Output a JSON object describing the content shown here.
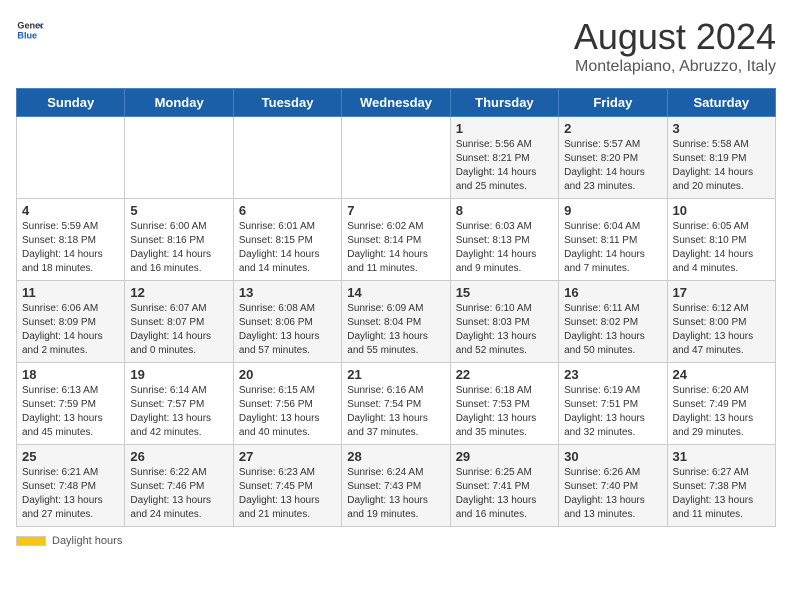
{
  "header": {
    "logo_general": "General",
    "logo_blue": "Blue",
    "month_title": "August 2024",
    "location": "Montelapiano, Abruzzo, Italy"
  },
  "days_of_week": [
    "Sunday",
    "Monday",
    "Tuesday",
    "Wednesday",
    "Thursday",
    "Friday",
    "Saturday"
  ],
  "footer": {
    "daylight_label": "Daylight hours"
  },
  "weeks": [
    [
      {
        "day": "",
        "info": ""
      },
      {
        "day": "",
        "info": ""
      },
      {
        "day": "",
        "info": ""
      },
      {
        "day": "",
        "info": ""
      },
      {
        "day": "1",
        "info": "Sunrise: 5:56 AM\nSunset: 8:21 PM\nDaylight: 14 hours\nand 25 minutes."
      },
      {
        "day": "2",
        "info": "Sunrise: 5:57 AM\nSunset: 8:20 PM\nDaylight: 14 hours\nand 23 minutes."
      },
      {
        "day": "3",
        "info": "Sunrise: 5:58 AM\nSunset: 8:19 PM\nDaylight: 14 hours\nand 20 minutes."
      }
    ],
    [
      {
        "day": "4",
        "info": "Sunrise: 5:59 AM\nSunset: 8:18 PM\nDaylight: 14 hours\nand 18 minutes."
      },
      {
        "day": "5",
        "info": "Sunrise: 6:00 AM\nSunset: 8:16 PM\nDaylight: 14 hours\nand 16 minutes."
      },
      {
        "day": "6",
        "info": "Sunrise: 6:01 AM\nSunset: 8:15 PM\nDaylight: 14 hours\nand 14 minutes."
      },
      {
        "day": "7",
        "info": "Sunrise: 6:02 AM\nSunset: 8:14 PM\nDaylight: 14 hours\nand 11 minutes."
      },
      {
        "day": "8",
        "info": "Sunrise: 6:03 AM\nSunset: 8:13 PM\nDaylight: 14 hours\nand 9 minutes."
      },
      {
        "day": "9",
        "info": "Sunrise: 6:04 AM\nSunset: 8:11 PM\nDaylight: 14 hours\nand 7 minutes."
      },
      {
        "day": "10",
        "info": "Sunrise: 6:05 AM\nSunset: 8:10 PM\nDaylight: 14 hours\nand 4 minutes."
      }
    ],
    [
      {
        "day": "11",
        "info": "Sunrise: 6:06 AM\nSunset: 8:09 PM\nDaylight: 14 hours\nand 2 minutes."
      },
      {
        "day": "12",
        "info": "Sunrise: 6:07 AM\nSunset: 8:07 PM\nDaylight: 14 hours\nand 0 minutes."
      },
      {
        "day": "13",
        "info": "Sunrise: 6:08 AM\nSunset: 8:06 PM\nDaylight: 13 hours\nand 57 minutes."
      },
      {
        "day": "14",
        "info": "Sunrise: 6:09 AM\nSunset: 8:04 PM\nDaylight: 13 hours\nand 55 minutes."
      },
      {
        "day": "15",
        "info": "Sunrise: 6:10 AM\nSunset: 8:03 PM\nDaylight: 13 hours\nand 52 minutes."
      },
      {
        "day": "16",
        "info": "Sunrise: 6:11 AM\nSunset: 8:02 PM\nDaylight: 13 hours\nand 50 minutes."
      },
      {
        "day": "17",
        "info": "Sunrise: 6:12 AM\nSunset: 8:00 PM\nDaylight: 13 hours\nand 47 minutes."
      }
    ],
    [
      {
        "day": "18",
        "info": "Sunrise: 6:13 AM\nSunset: 7:59 PM\nDaylight: 13 hours\nand 45 minutes."
      },
      {
        "day": "19",
        "info": "Sunrise: 6:14 AM\nSunset: 7:57 PM\nDaylight: 13 hours\nand 42 minutes."
      },
      {
        "day": "20",
        "info": "Sunrise: 6:15 AM\nSunset: 7:56 PM\nDaylight: 13 hours\nand 40 minutes."
      },
      {
        "day": "21",
        "info": "Sunrise: 6:16 AM\nSunset: 7:54 PM\nDaylight: 13 hours\nand 37 minutes."
      },
      {
        "day": "22",
        "info": "Sunrise: 6:18 AM\nSunset: 7:53 PM\nDaylight: 13 hours\nand 35 minutes."
      },
      {
        "day": "23",
        "info": "Sunrise: 6:19 AM\nSunset: 7:51 PM\nDaylight: 13 hours\nand 32 minutes."
      },
      {
        "day": "24",
        "info": "Sunrise: 6:20 AM\nSunset: 7:49 PM\nDaylight: 13 hours\nand 29 minutes."
      }
    ],
    [
      {
        "day": "25",
        "info": "Sunrise: 6:21 AM\nSunset: 7:48 PM\nDaylight: 13 hours\nand 27 minutes."
      },
      {
        "day": "26",
        "info": "Sunrise: 6:22 AM\nSunset: 7:46 PM\nDaylight: 13 hours\nand 24 minutes."
      },
      {
        "day": "27",
        "info": "Sunrise: 6:23 AM\nSunset: 7:45 PM\nDaylight: 13 hours\nand 21 minutes."
      },
      {
        "day": "28",
        "info": "Sunrise: 6:24 AM\nSunset: 7:43 PM\nDaylight: 13 hours\nand 19 minutes."
      },
      {
        "day": "29",
        "info": "Sunrise: 6:25 AM\nSunset: 7:41 PM\nDaylight: 13 hours\nand 16 minutes."
      },
      {
        "day": "30",
        "info": "Sunrise: 6:26 AM\nSunset: 7:40 PM\nDaylight: 13 hours\nand 13 minutes."
      },
      {
        "day": "31",
        "info": "Sunrise: 6:27 AM\nSunset: 7:38 PM\nDaylight: 13 hours\nand 11 minutes."
      }
    ]
  ]
}
